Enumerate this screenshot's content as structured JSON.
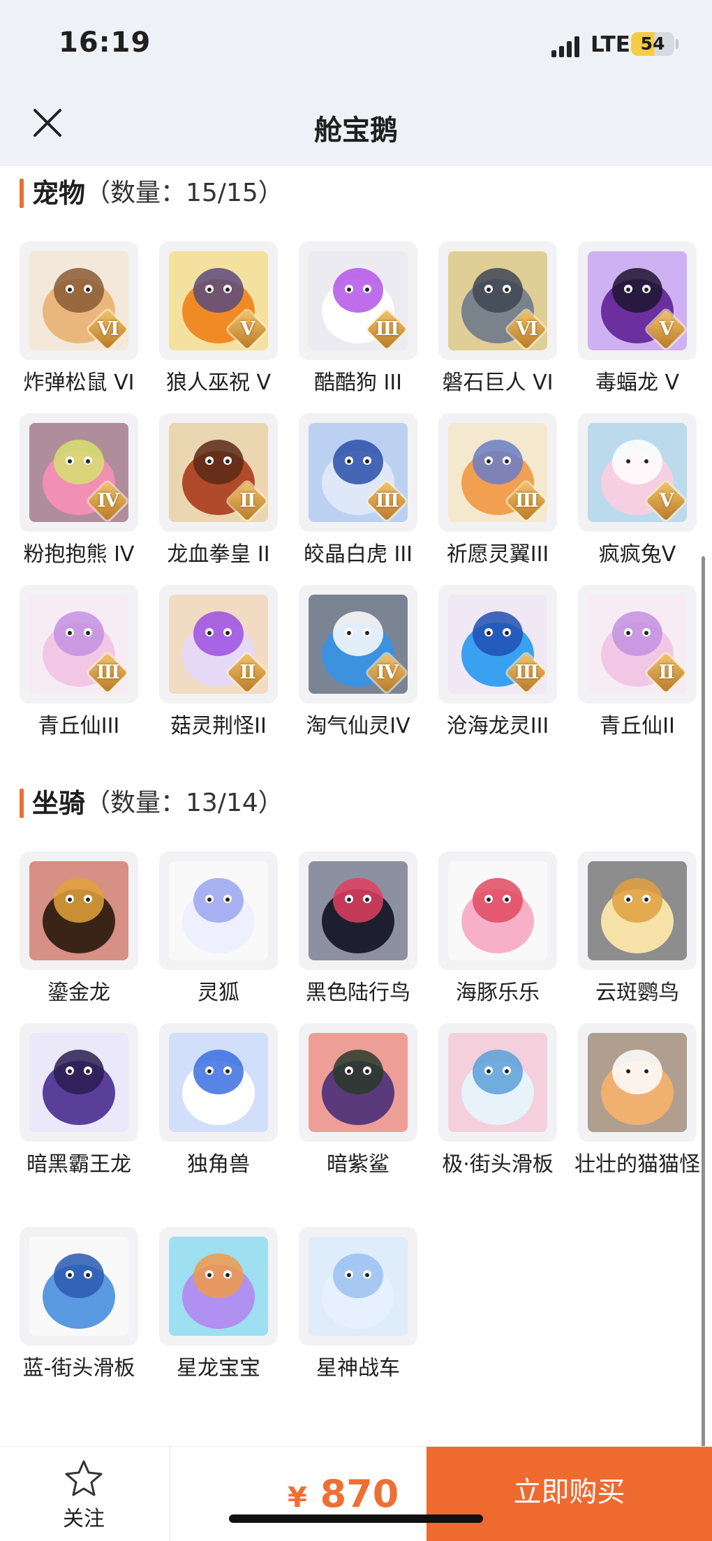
{
  "status_bar": {
    "time": "16:19",
    "network": "LTE",
    "battery": "54"
  },
  "header": {
    "title": "舱宝鹅"
  },
  "pets": {
    "title": "宠物",
    "count": "（数量：15/15）",
    "items": [
      {
        "label": "炸弹松鼠 VI",
        "tier": "VI",
        "art": "squirrel"
      },
      {
        "label": "狼人巫祝 V",
        "tier": "V",
        "art": "wolf"
      },
      {
        "label": "酷酷狗 III",
        "tier": "III",
        "art": "dog"
      },
      {
        "label": "磐石巨人 VI",
        "tier": "VI",
        "art": "golem"
      },
      {
        "label": "毒蝠龙 V",
        "tier": "V",
        "art": "dragon"
      },
      {
        "label": "粉抱抱熊 IV",
        "tier": "IV",
        "art": "bear"
      },
      {
        "label": "龙血拳皇 II",
        "tier": "II",
        "art": "ram"
      },
      {
        "label": "皎晶白虎 III",
        "tier": "III",
        "art": "tiger"
      },
      {
        "label": "祈愿灵翼III",
        "tier": "III",
        "art": "bird"
      },
      {
        "label": "疯疯兔V",
        "tier": "V",
        "art": "rabbit"
      },
      {
        "label": "青丘仙III",
        "tier": "III",
        "art": "fox-girl"
      },
      {
        "label": "菇灵荆怪II",
        "tier": "II",
        "art": "mushroom"
      },
      {
        "label": "淘气仙灵IV",
        "tier": "IV",
        "art": "puppy"
      },
      {
        "label": "沧海龙灵III",
        "tier": "III",
        "art": "sea-dragon"
      },
      {
        "label": "青丘仙II",
        "tier": "II",
        "art": "fox-girl"
      }
    ]
  },
  "mounts": {
    "title": "坐骑",
    "count": "（数量：13/14）",
    "items": [
      {
        "label": "鎏金龙",
        "art": "gold-dragon"
      },
      {
        "label": "灵狐",
        "art": "spirit-fox"
      },
      {
        "label": "黑色陆行鸟",
        "art": "black-bird"
      },
      {
        "label": "海豚乐乐",
        "art": "dolphin"
      },
      {
        "label": "云斑鹦鸟",
        "art": "parrot"
      },
      {
        "label": "暗黑霸王龙",
        "art": "trex"
      },
      {
        "label": "独角兽",
        "art": "unicorn"
      },
      {
        "label": "暗紫鲨",
        "art": "shark"
      },
      {
        "label": "极·街头滑板",
        "art": "skateboard-white"
      },
      {
        "label": "壮壮的猫猫怪",
        "art": "cat"
      },
      {
        "label": "蓝-街头滑板",
        "art": "skateboard-blue"
      },
      {
        "label": "星龙宝宝",
        "art": "baby-dragon"
      },
      {
        "label": "星神战车",
        "art": "chariot"
      }
    ]
  },
  "footer": {
    "follow_label": "关注",
    "price_symbol": "¥",
    "price_value": "870",
    "buy_label": "立即购买"
  },
  "colors": {
    "accent": "#ee6f34",
    "buy_button": "#ee6a2f"
  }
}
